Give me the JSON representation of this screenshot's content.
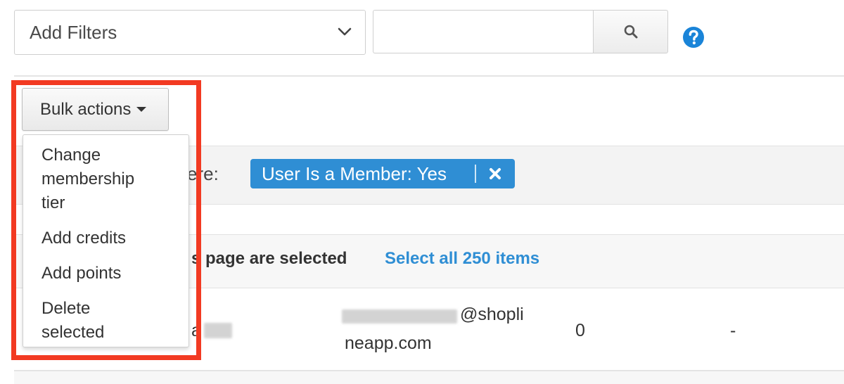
{
  "filters": {
    "label": "Add Filters"
  },
  "search": {
    "value": "",
    "placeholder": ""
  },
  "help": {
    "icon": "question-circle-icon",
    "color": "#1a84d8"
  },
  "bulk_actions": {
    "label": "Bulk actions",
    "menu": [
      "Change membership tier",
      "Add credits",
      "Add points",
      "Delete selected"
    ]
  },
  "active_filters": {
    "prefix_visible": "ere:",
    "chip_label": "User Is a Member: Yes",
    "chip_color": "#2f8ed4"
  },
  "selection": {
    "text_visible": "s page are selected",
    "select_all_label": "Select all 250 items",
    "link_color": "#2f8ed4"
  },
  "row": {
    "name_visible": "a",
    "email_domain_line1": "@shopli",
    "email_domain_line2": "neapp.com",
    "value": "0",
    "placeholder": "-"
  },
  "annotation": {
    "highlight_color": "#f23a22"
  }
}
